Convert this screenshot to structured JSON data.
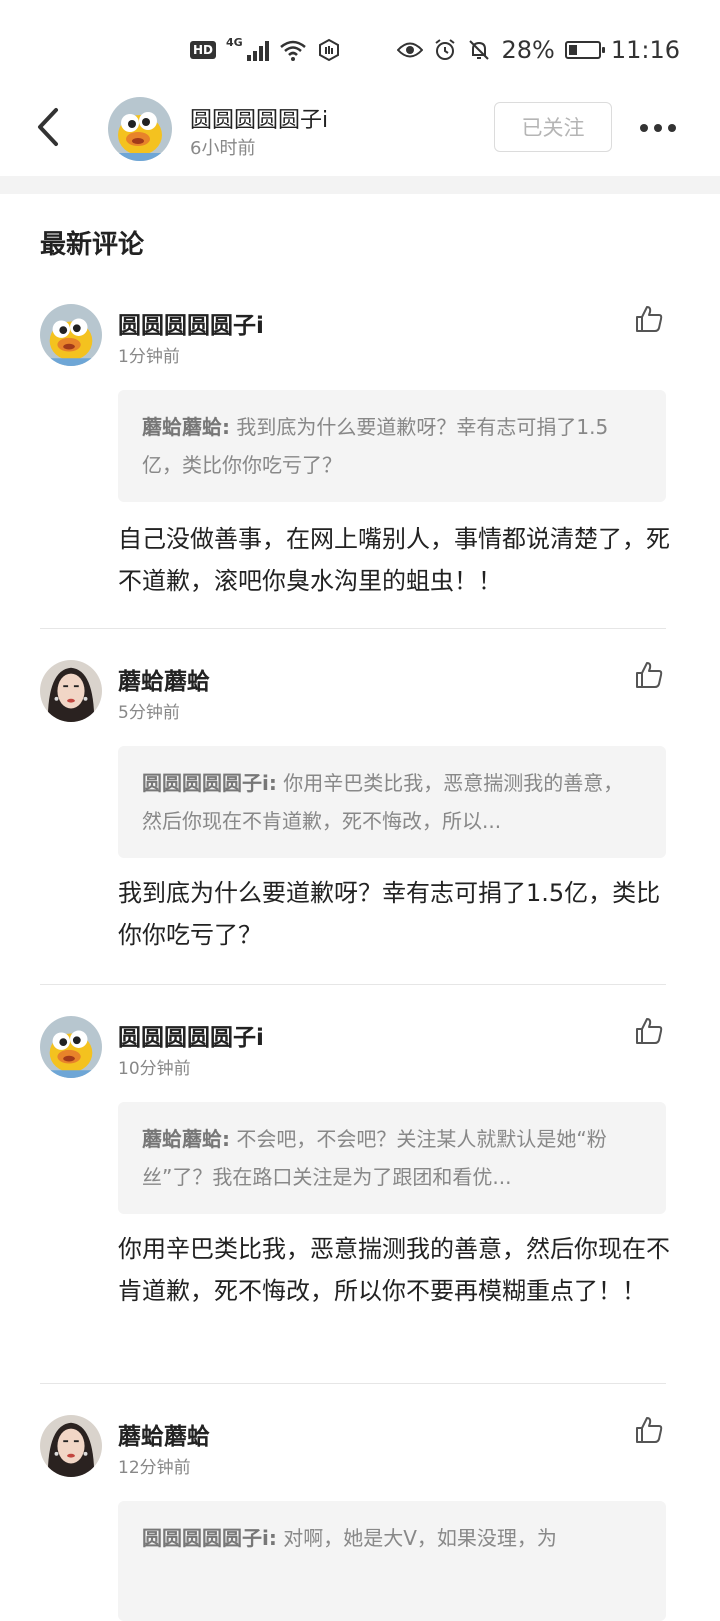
{
  "status_bar": {
    "hd": "HD",
    "network": "4G",
    "battery": "28%",
    "battery_level": 0.28,
    "time": "11:16",
    "icons": [
      "hd-icon",
      "signal-icon",
      "wifi-icon",
      "nfc-icon",
      "eye-icon",
      "alarm-icon",
      "mute-icon",
      "battery-icon"
    ]
  },
  "header": {
    "name": "圆圆圆圆圆子i",
    "time": "6小时前",
    "follow_label": "已关注"
  },
  "section_title": "最新评论",
  "comments": [
    {
      "name": "圆圆圆圆圆子i",
      "time": "1分钟前",
      "quote_author": "蘑蛤蘑蛤:",
      "quote_text": "我到底为什么要道歉呀？幸有志可捐了1.5亿，类比你你吃亏了？",
      "text": "自己没做善事，在网上嘴别人，事情都说清楚了，死不道歉，滚吧你臭水沟里的蛆虫！！"
    },
    {
      "name": "蘑蛤蘑蛤",
      "time": "5分钟前",
      "quote_author": "圆圆圆圆圆子i:",
      "quote_text": "你用辛巴类比我，恶意揣测我的善意，然后你现在不肯道歉，死不悔改，所以...",
      "text": "我到底为什么要道歉呀？幸有志可捐了1.5亿，类比你你吃亏了？"
    },
    {
      "name": "圆圆圆圆圆子i",
      "time": "10分钟前",
      "quote_author": "蘑蛤蘑蛤:",
      "quote_text": "不会吧，不会吧？关注某人就默认是她“粉丝”了？我在路口关注是为了跟团和看优...",
      "text": "你用辛巴类比我，恶意揣测我的善意，然后你现在不肯道歉，死不悔改，所以你不要再模糊重点了！！"
    },
    {
      "name": "蘑蛤蘑蛤",
      "time": "12分钟前",
      "quote_author": "圆圆圆圆圆子i:",
      "quote_text": "对啊，她是大V，如果没理，为"
    }
  ]
}
